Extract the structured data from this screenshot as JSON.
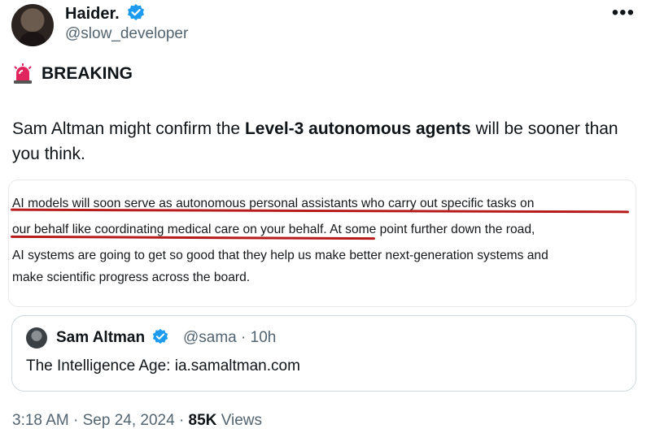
{
  "author": {
    "name": "Haider.",
    "handle": "@slow_developer"
  },
  "post": {
    "breaking_label": "BREAKING",
    "text_before": "Sam Altman might confirm the ",
    "text_bold": "Level-3 autonomous agents",
    "text_after": " will be sooner than you think."
  },
  "quote_image": {
    "lines": [
      "AI models will soon serve as autonomous personal assistants who carry out specific tasks on",
      "our behalf like coordinating medical care on your behalf. At some point further down the road,",
      "AI systems are going to get so good that they help us make better next-generation systems and",
      "make scientific progress across the board."
    ],
    "underline_color": "#b71c1c"
  },
  "quoted_post": {
    "name": "Sam Altman",
    "handle": "@sama",
    "time": "10h",
    "separator": "·",
    "text": "The Intelligence Age: ia.samaltman.com"
  },
  "meta": {
    "time": "3:18 AM",
    "date": "Sep 24, 2024",
    "separator": "·",
    "views": "85K",
    "views_label": "Views"
  },
  "icons": {
    "verified": "verified-badge-icon",
    "siren": "siren-icon",
    "more": "more-options-icon"
  },
  "colors": {
    "verified": "#1d9bf0",
    "siren": "#e0245e",
    "secondary_text": "#536471"
  }
}
